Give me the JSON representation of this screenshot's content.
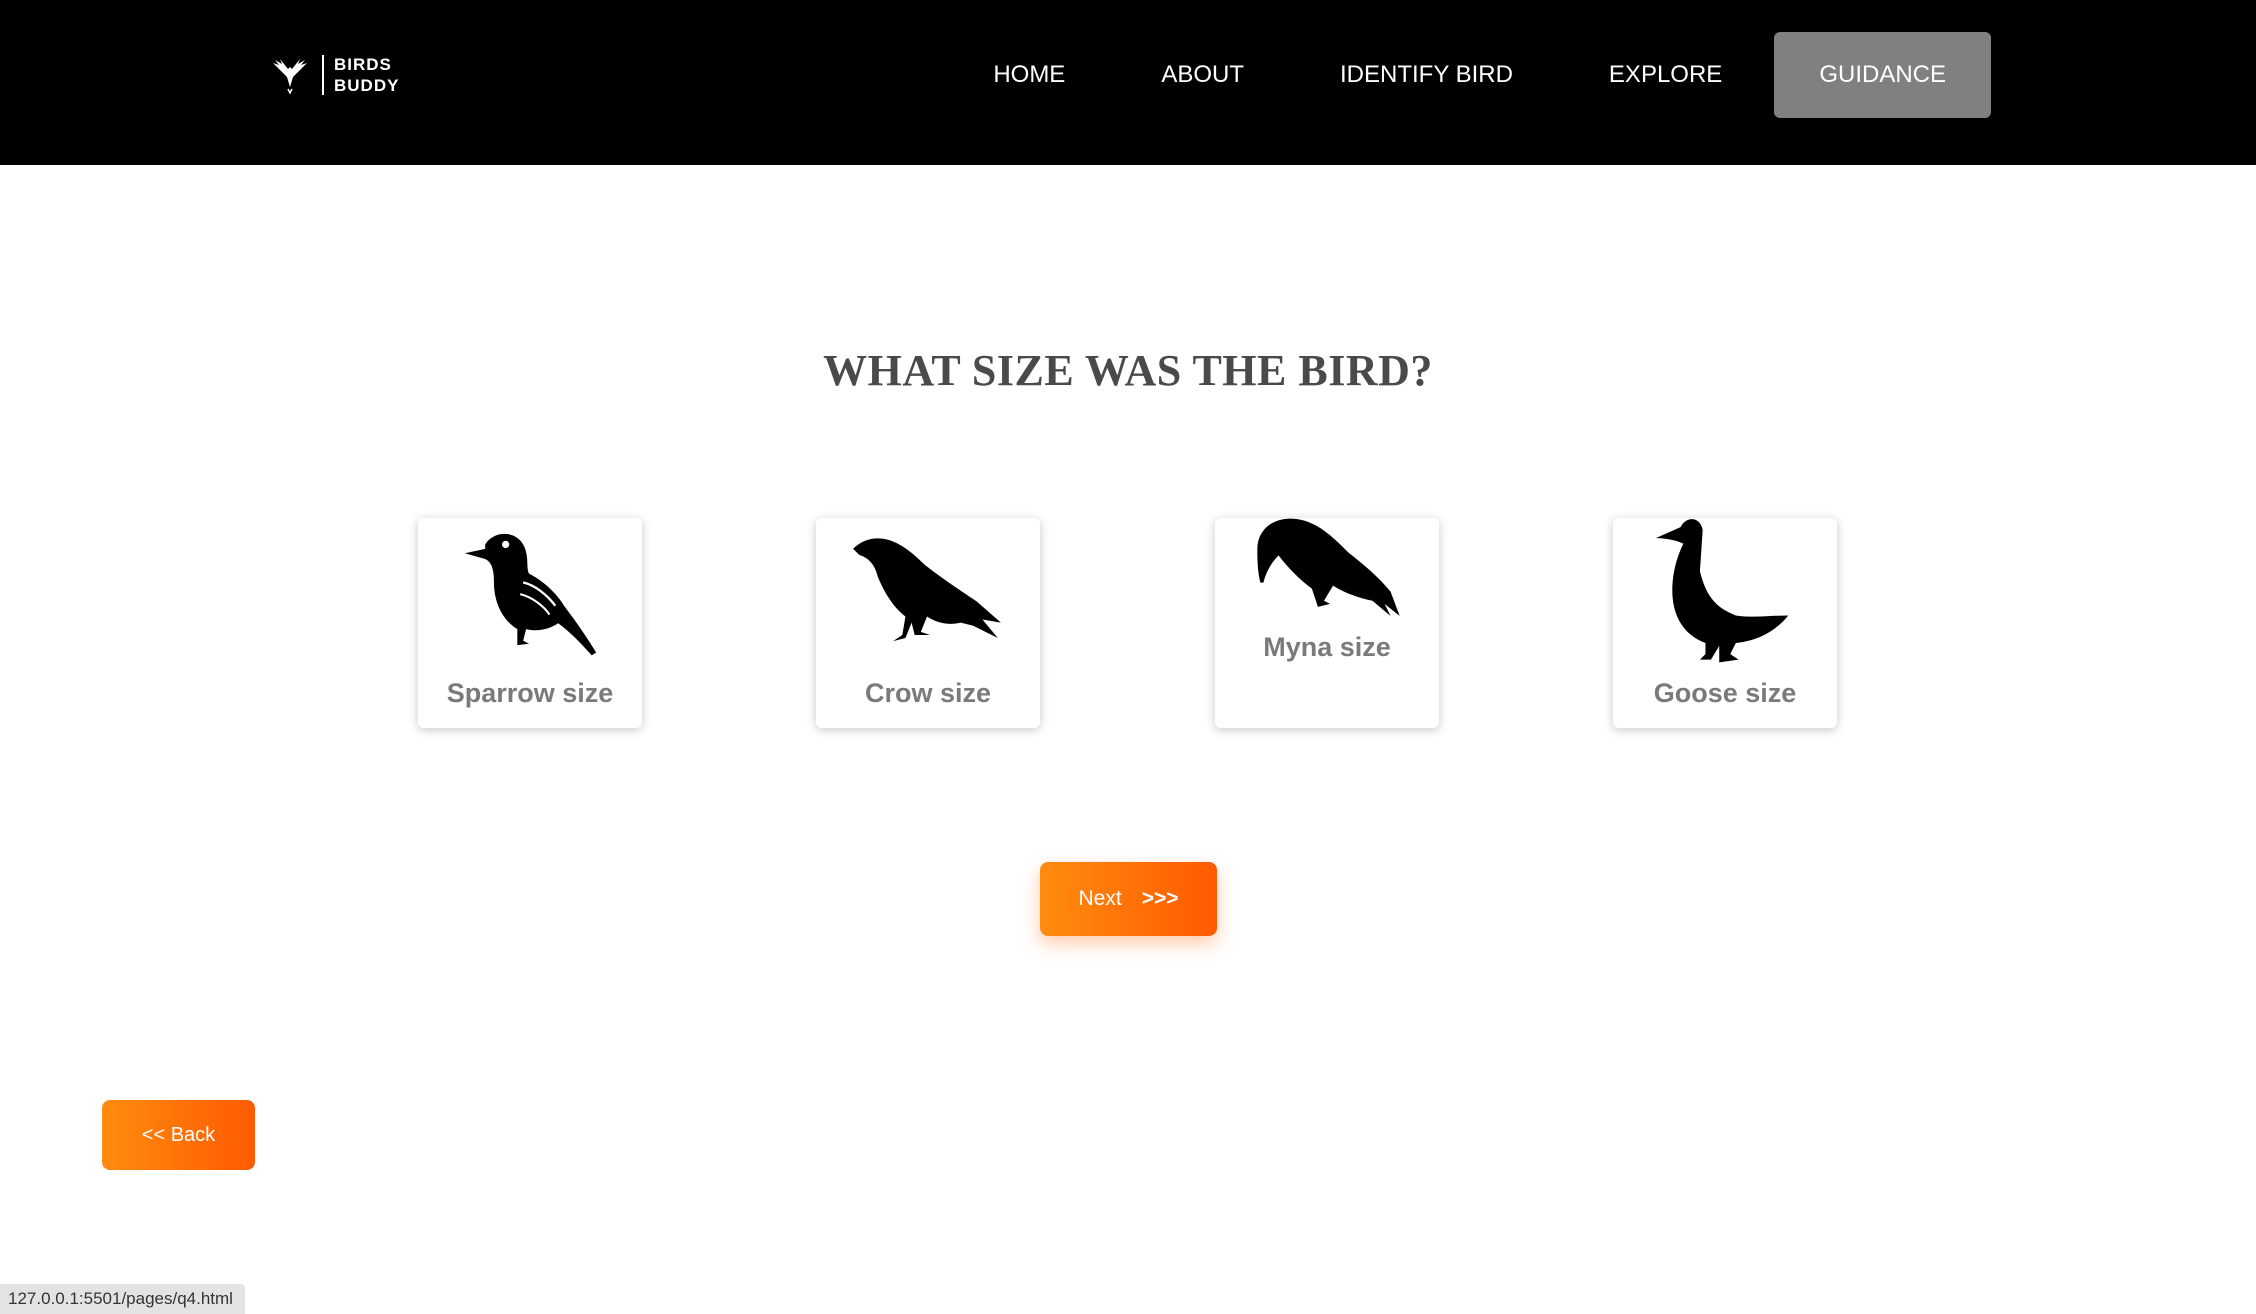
{
  "navbar": {
    "brand": {
      "line1": "BIRDS",
      "line2": "BUDDY",
      "logo_icon": "bird-wings-icon"
    },
    "links": [
      {
        "label": "HOME"
      },
      {
        "label": "ABOUT"
      },
      {
        "label": "IDENTIFY BIRD"
      },
      {
        "label": "EXPLORE"
      },
      {
        "label": "GUIDANCE",
        "active": true
      }
    ]
  },
  "question": {
    "title": "WHAT SIZE WAS THE BIRD?"
  },
  "options": [
    {
      "label": "Sparrow size",
      "icon": "sparrow-icon"
    },
    {
      "label": "Crow size",
      "icon": "crow-icon"
    },
    {
      "label": "Myna size",
      "icon": "myna-icon"
    },
    {
      "label": "Goose size",
      "icon": "goose-icon"
    }
  ],
  "buttons": {
    "next_label": "Next",
    "next_arrows": ">>>",
    "back_label": "<< Back"
  },
  "status_bar": {
    "url": "127.0.0.1:5501/pages/q4.html"
  },
  "colors": {
    "navbar_bg": "#000000",
    "nav_active_bg": "#808080",
    "accent_gradient_start": "#ff8c10",
    "accent_gradient_end": "#ff5a00",
    "title_color": "#4a4a4a",
    "card_label_color": "#7a7a7a"
  }
}
